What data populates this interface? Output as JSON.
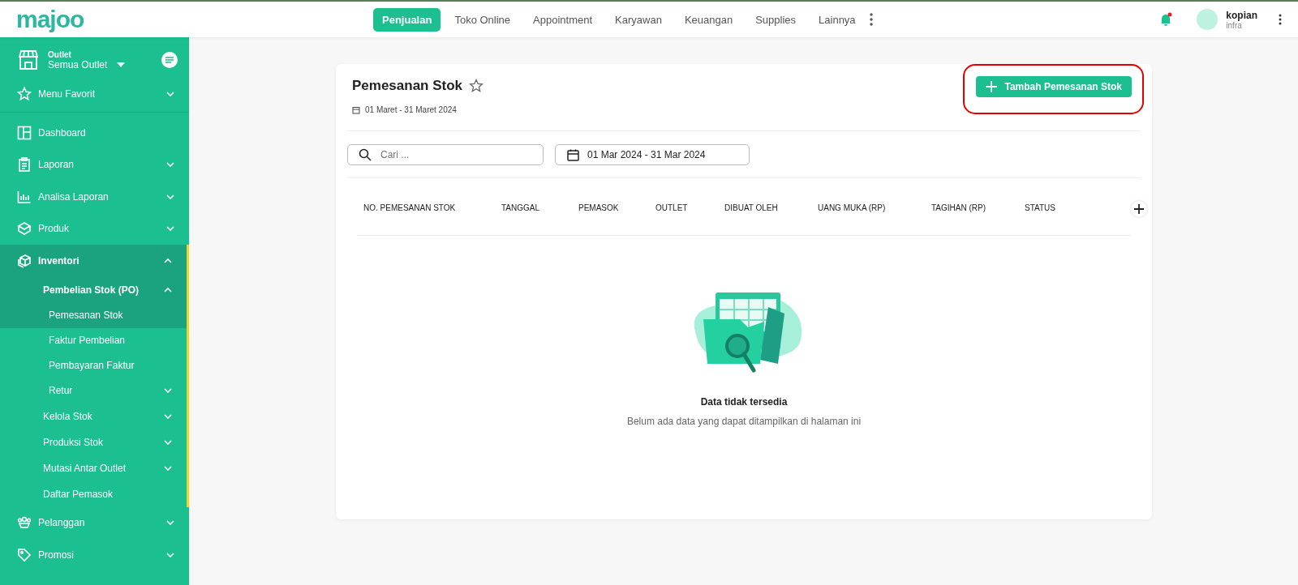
{
  "logo": "majoo",
  "nav": {
    "tabs": [
      {
        "label": "Penjualan",
        "selected": true
      },
      {
        "label": "Toko Online",
        "selected": false
      },
      {
        "label": "Appointment",
        "selected": false
      },
      {
        "label": "Karyawan",
        "selected": false
      },
      {
        "label": "Keuangan",
        "selected": false
      },
      {
        "label": "Supplies",
        "selected": false
      },
      {
        "label": "Lainnya",
        "selected": false
      }
    ]
  },
  "notifications": {
    "unread": true
  },
  "user": {
    "name": "kopian",
    "role": "infra"
  },
  "outlet": {
    "label": "Outlet",
    "value": "Semua Outlet"
  },
  "favorites": {
    "label": "Menu Favorit",
    "expanded": false
  },
  "sidebar": {
    "items": [
      {
        "label": "Dashboard",
        "selected": false
      },
      {
        "label": "Laporan",
        "selected": false,
        "expanded": false
      },
      {
        "label": "Analisa Laporan",
        "selected": false,
        "expanded": false
      },
      {
        "label": "Produk",
        "selected": false,
        "expanded": false
      },
      {
        "label": "Inventori",
        "selected": true,
        "expanded": true,
        "children": [
          {
            "label": "Pembelian Stok (PO)",
            "selected": true,
            "expanded": true,
            "children": [
              {
                "label": "Pemesanan Stok",
                "selected": true
              },
              {
                "label": "Faktur Pembelian",
                "selected": false
              },
              {
                "label": "Pembayaran Faktur",
                "selected": false
              },
              {
                "label": "Retur",
                "selected": false,
                "expanded": false
              }
            ]
          },
          {
            "label": "Kelola Stok",
            "selected": false,
            "expanded": false
          },
          {
            "label": "Produksi Stok",
            "selected": false,
            "expanded": false
          },
          {
            "label": "Mutasi Antar Outlet",
            "selected": false,
            "expanded": false
          },
          {
            "label": "Daftar Pemasok",
            "selected": false
          }
        ]
      },
      {
        "label": "Pelanggan",
        "selected": false,
        "expanded": false
      },
      {
        "label": "Promosi",
        "selected": false,
        "expanded": false
      }
    ]
  },
  "page": {
    "title": "Pemesanan Stok",
    "favorite": false,
    "period": "01 Maret - 31 Maret 2024",
    "add_button": {
      "label": "Tambah Pemesanan Stok",
      "highlighted": true
    },
    "search": {
      "placeholder": "Cari ..."
    },
    "date_range": "01 Mar 2024 - 31 Mar 2024",
    "table": {
      "columns": [
        "NO. PEMESANAN STOK",
        "TANGGAL",
        "PEMASOK",
        "OUTLET",
        "DIBUAT OLEH",
        "UANG MUKA (RP)",
        "TAGIHAN (RP)",
        "STATUS"
      ]
    },
    "empty": {
      "title": "Data tidak tersedia",
      "message": "Belum ada data yang dapat ditampilkan di halaman ini"
    }
  }
}
